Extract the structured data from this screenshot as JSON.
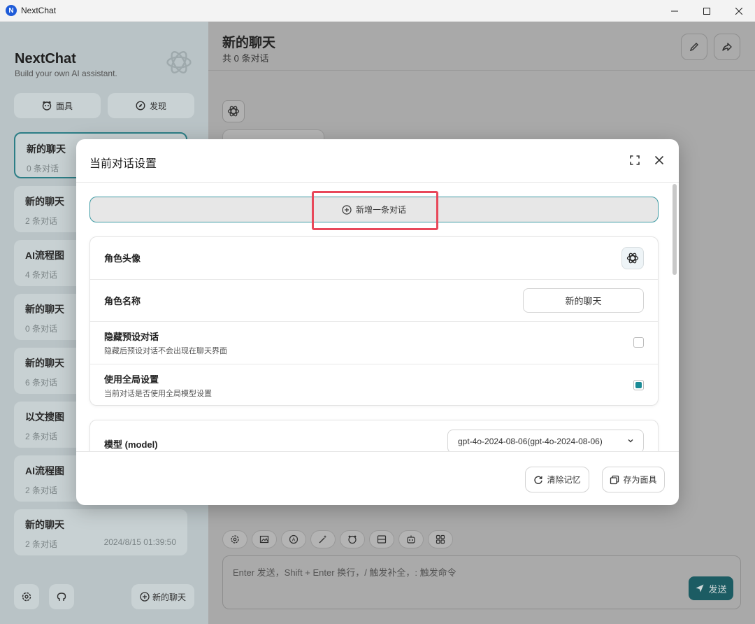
{
  "window": {
    "title": "NextChat",
    "controls": [
      "minimize",
      "maximize",
      "close"
    ]
  },
  "sidebar": {
    "title": "NextChat",
    "subtitle": "Build your own AI assistant.",
    "tools": [
      {
        "label": "面具",
        "icon": "mask-icon"
      },
      {
        "label": "发现",
        "icon": "compass-icon"
      }
    ],
    "chats": [
      {
        "name": "新的聊天",
        "count": "0 条对话",
        "date": "",
        "active": true
      },
      {
        "name": "新的聊天",
        "count": "2 条对话",
        "date": ""
      },
      {
        "name": "AI流程图",
        "count": "4 条对话",
        "date": ""
      },
      {
        "name": "新的聊天",
        "count": "0 条对话",
        "date": ""
      },
      {
        "name": "新的聊天",
        "count": "6 条对话",
        "date": ""
      },
      {
        "name": "以文搜图",
        "count": "2 条对话",
        "date": ""
      },
      {
        "name": "AI流程图",
        "count": "2 条对话",
        "date": ""
      },
      {
        "name": "新的聊天",
        "count": "2 条对话",
        "date": "2024/8/15 01:39:50"
      }
    ],
    "new_chat_label": "新的聊天"
  },
  "main": {
    "title": "新的聊天",
    "subtitle": "共 0 条对话",
    "input_placeholder": "Enter 发送，Shift + Enter 换行，/ 触发补全，: 触发命令",
    "send_label": "发送"
  },
  "modal": {
    "title": "当前对话设置",
    "add_message_label": "新增一条对话",
    "settings": {
      "avatar_label": "角色头像",
      "name_label": "角色名称",
      "name_value": "新的聊天",
      "hide_context_label": "隐藏预设对话",
      "hide_context_desc": "隐藏后预设对话不会出现在聊天界面",
      "hide_context_checked": false,
      "use_global_label": "使用全局设置",
      "use_global_desc": "当前对话是否使用全局模型设置",
      "use_global_checked": true
    },
    "model_label": "模型 (model)",
    "model_value": "gpt-4o-2024-08-06(gpt-4o-2024-08-06)",
    "clear_memory_label": "清除记忆",
    "save_mask_label": "存为面具"
  },
  "colors": {
    "accent": "#1a8b96",
    "highlight": "#e8485a",
    "sidebar_bg": "#b9c3c6"
  }
}
